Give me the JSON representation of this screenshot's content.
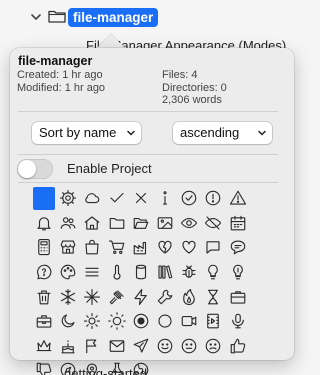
{
  "tree": {
    "selected_folder": "file-manager",
    "behind_item": "File Manager Appearance (Modes)",
    "bottom_item": "getting-started"
  },
  "popover": {
    "title": "file-manager",
    "created": "Created: 1 hr ago",
    "modified": "Modified: 1 hr ago",
    "files": "Files: 4",
    "directories": "Directories: 0",
    "words": "2,306 words",
    "sort_select": "Sort by name",
    "order_select": "ascending",
    "toggle_label": "Enable Project",
    "toggle_on": false,
    "selected_color": "#1a6ef5",
    "icons": [
      "color-swatch",
      "gear",
      "cloud",
      "check",
      "x",
      "info",
      "check-circle",
      "alert-circle",
      "warning",
      "bell",
      "users",
      "house",
      "folder",
      "folder-open",
      "image",
      "eye",
      "eye-off",
      "calendar",
      "calculator",
      "shop",
      "bag",
      "cart",
      "factory",
      "heart-broken",
      "heart",
      "chat",
      "chat-text",
      "chat-question",
      "palette",
      "menu",
      "thermometer",
      "cylinder",
      "books",
      "bug",
      "lightbulb",
      "lightbulb-alt",
      "trash",
      "snowflake",
      "snowflake-alt",
      "gavel",
      "bolt",
      "wrench",
      "flame",
      "hourglass",
      "briefcase",
      "toolbox",
      "moon",
      "sun",
      "sun-alt",
      "record",
      "circle",
      "video",
      "film",
      "mic",
      "crown",
      "cake",
      "flag",
      "mail",
      "plane",
      "smile",
      "neutral",
      "frown",
      "thumbs-up",
      "thumbs-down",
      "compass",
      "pin",
      "flask",
      "globe"
    ]
  }
}
